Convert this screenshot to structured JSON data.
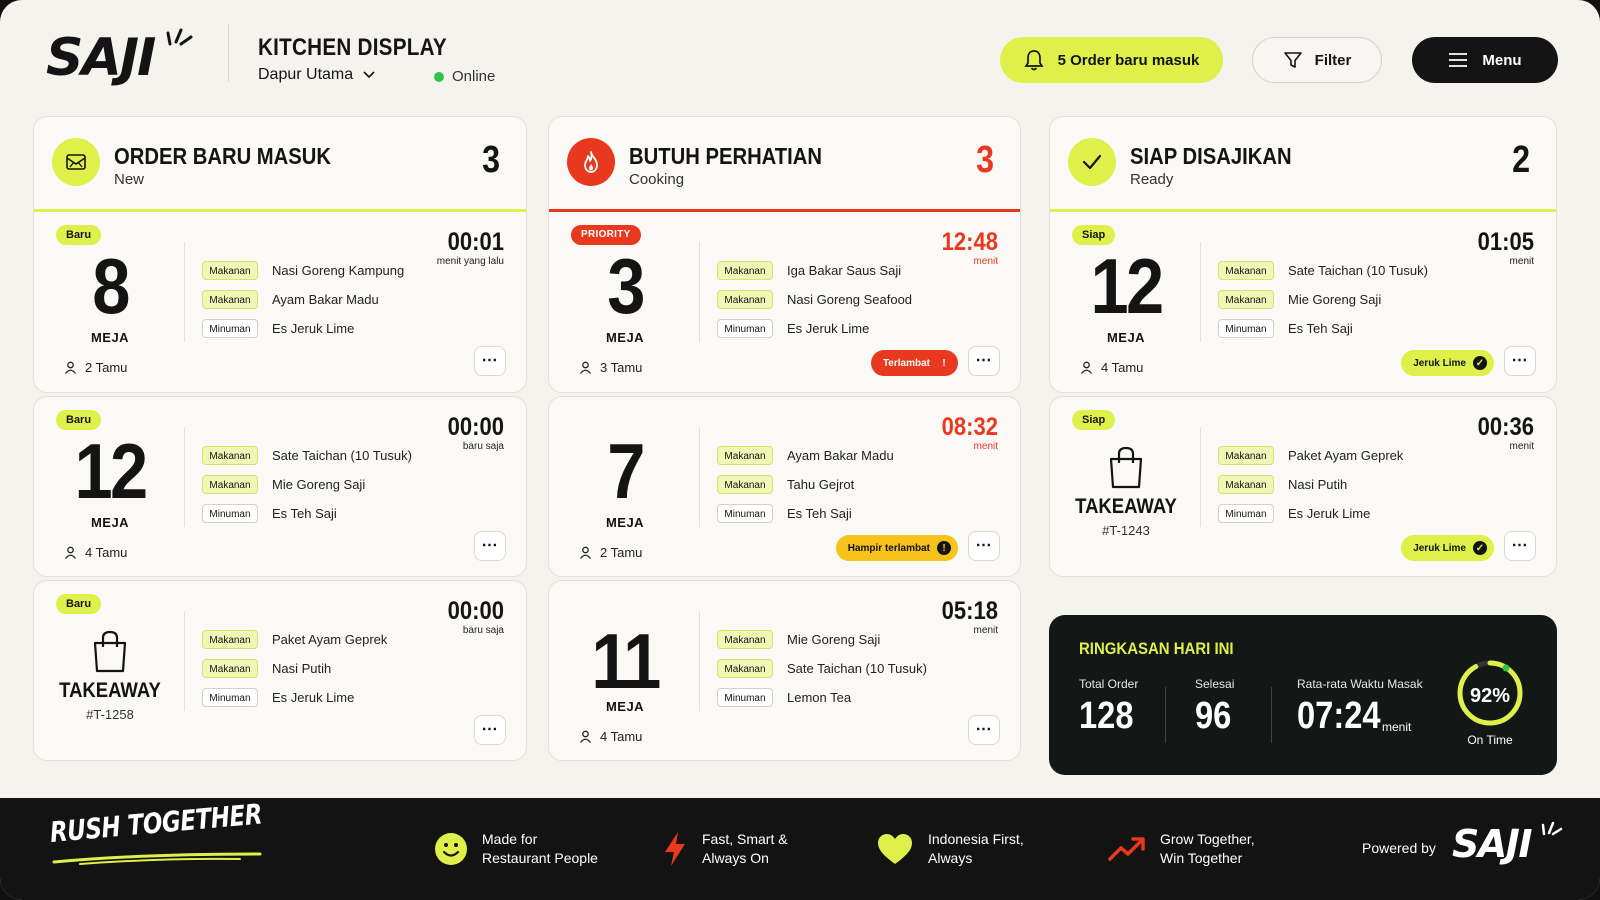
{
  "header": {
    "logo": "SAJI",
    "title": "KITCHEN DISPLAY",
    "location": "Dapur Utama",
    "status": "Online",
    "orders_button": "5 Order baru masuk",
    "filter_button": "Filter",
    "menu_button": "Menu"
  },
  "columns": {
    "new": {
      "title": "ORDER BARU MASUK",
      "subtitle": "New",
      "count": "3",
      "cards": [
        {
          "badge": "Baru",
          "table": "8",
          "table_label": "MEJA",
          "guests": "2 Tamu",
          "timer": "00:01",
          "timer_sub": "menit yang lalu",
          "items": [
            {
              "tag": "Makanan",
              "name": "Nasi Goreng Kampung"
            },
            {
              "tag": "Makanan",
              "name": "Ayam Bakar Madu"
            },
            {
              "tag": "Minuman",
              "name": "Es Jeruk Lime"
            }
          ]
        },
        {
          "badge": "Baru",
          "table": "12",
          "table_label": "MEJA",
          "guests": "4 Tamu",
          "timer": "00:00",
          "timer_sub": "baru saja",
          "items": [
            {
              "tag": "Makanan",
              "name": "Sate Taichan (10 Tusuk)"
            },
            {
              "tag": "Makanan",
              "name": "Mie Goreng Saji"
            },
            {
              "tag": "Minuman",
              "name": "Es Teh Saji"
            }
          ]
        },
        {
          "badge": "Baru",
          "takeaway": "TAKEAWAY",
          "order_id": "#T-1258",
          "timer": "00:00",
          "timer_sub": "baru saja",
          "items": [
            {
              "tag": "Makanan",
              "name": "Paket Ayam Geprek"
            },
            {
              "tag": "Makanan",
              "name": "Nasi Putih"
            },
            {
              "tag": "Minuman",
              "name": "Es Jeruk Lime"
            }
          ]
        }
      ]
    },
    "attention": {
      "title": "BUTUH PERHATIAN",
      "subtitle": "Cooking",
      "count": "3",
      "cards": [
        {
          "badge": "PRIORITY",
          "table": "3",
          "table_label": "MEJA",
          "guests": "3 Tamu",
          "timer": "12:48",
          "timer_sub": "menit",
          "alert": "Terlambat",
          "items": [
            {
              "tag": "Makanan",
              "name": "Iga Bakar Saus Saji"
            },
            {
              "tag": "Makanan",
              "name": "Nasi Goreng Seafood"
            },
            {
              "tag": "Minuman",
              "name": "Es Jeruk Lime"
            }
          ]
        },
        {
          "table": "7",
          "table_label": "MEJA",
          "guests": "2 Tamu",
          "timer": "08:32",
          "timer_sub": "menit",
          "alert": "Hampir terlambat",
          "items": [
            {
              "tag": "Makanan",
              "name": "Ayam Bakar Madu"
            },
            {
              "tag": "Makanan",
              "name": "Tahu Gejrot"
            },
            {
              "tag": "Minuman",
              "name": "Es Teh Saji"
            }
          ]
        },
        {
          "table": "11",
          "table_label": "MEJA",
          "guests": "4 Tamu",
          "timer": "05:18",
          "timer_sub": "menit",
          "items": [
            {
              "tag": "Makanan",
              "name": "Mie Goreng Saji"
            },
            {
              "tag": "Makanan",
              "name": "Sate Taichan (10 Tusuk)"
            },
            {
              "tag": "Minuman",
              "name": "Lemon Tea"
            }
          ]
        }
      ]
    },
    "ready": {
      "title": "SIAP DISAJIKAN",
      "subtitle": "Ready",
      "count": "2",
      "cards": [
        {
          "badge": "Siap",
          "table": "12",
          "table_label": "MEJA",
          "guests": "4 Tamu",
          "timer": "01:05",
          "timer_sub": "menit",
          "chip": "Jeruk Lime",
          "items": [
            {
              "tag": "Makanan",
              "name": "Sate Taichan (10 Tusuk)"
            },
            {
              "tag": "Makanan",
              "name": "Mie Goreng Saji"
            },
            {
              "tag": "Minuman",
              "name": "Es Teh Saji"
            }
          ]
        },
        {
          "badge": "Siap",
          "takeaway": "TAKEAWAY",
          "order_id": "#T-1243",
          "timer": "00:36",
          "timer_sub": "menit",
          "chip": "Jeruk Lime",
          "items": [
            {
              "tag": "Makanan",
              "name": "Paket Ayam Geprek"
            },
            {
              "tag": "Makanan",
              "name": "Nasi Putih"
            },
            {
              "tag": "Minuman",
              "name": "Es Jeruk Lime"
            }
          ]
        }
      ]
    }
  },
  "summary": {
    "title": "RINGKASAN HARI INI",
    "total_label": "Total Order",
    "total_value": "128",
    "done_label": "Selesai",
    "done_value": "96",
    "avg_label": "Rata-rata Waktu Masak",
    "avg_value": "07:24",
    "avg_unit": "menit",
    "on_time_pct": "92%",
    "on_time_fraction": 0.92,
    "on_time_label": "On Time"
  },
  "footer": {
    "tagline": "RUSH TOGETHER",
    "features": [
      {
        "icon": "smiley-icon",
        "line1": "Made for",
        "line2": "Restaurant People"
      },
      {
        "icon": "lightning-icon",
        "line1": "Fast, Smart &",
        "line2": "Always On"
      },
      {
        "icon": "heart-icon",
        "line1": "Indonesia First,",
        "line2": "Always"
      },
      {
        "icon": "trend-up-icon",
        "line1": "Grow Together,",
        "line2": "Win Together"
      }
    ],
    "powered_by": "Powered by",
    "logo": "SAJI"
  },
  "colors": {
    "accent": "#dff04a",
    "danger": "#e8381e",
    "warning": "#f6c21c",
    "dark": "#131716",
    "background": "#f5f3ee"
  }
}
